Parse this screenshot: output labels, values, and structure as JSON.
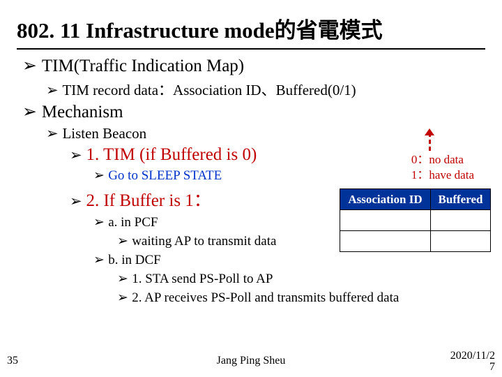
{
  "title_en": "802. 11 Infrastructure mode",
  "title_zh": "的省電模式",
  "l1a": "TIM(Traffic Indication Map)",
  "l1a_sub": "TIM record data：Association ID、Buffered(0/1)",
  "l1b": "Mechanism",
  "l2a": "Listen Beacon",
  "l3a": "1. TIM (if Buffered is 0)",
  "l4a": "Go to SLEEP STATE",
  "l3b": "2. If Buffer is 1：",
  "l4b": "a. in PCF",
  "l5b": "waiting AP to transmit data",
  "l4c": "b. in DCF",
  "l5c": "1. STA send PS-Poll to AP",
  "l5d": "2. AP receives PS-Poll and transmits buffered data",
  "legend_0": "0：no data",
  "legend_1": "1：have data",
  "th1": "Association ID",
  "th2": "Buffered",
  "page_num": "35",
  "author": "Jang Ping Sheu",
  "date1": "2020/11/2",
  "date2": "7"
}
